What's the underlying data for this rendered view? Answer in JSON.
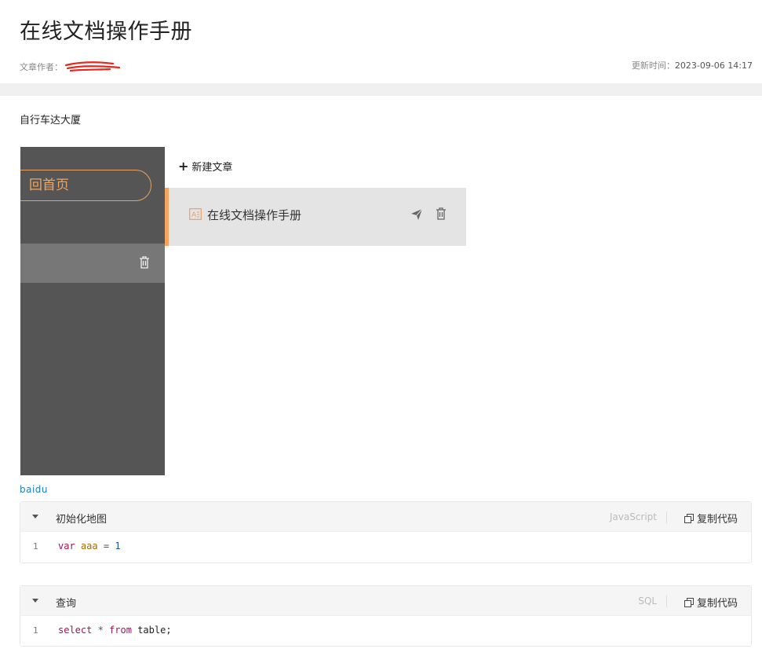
{
  "article": {
    "title": "在线文档操作手册",
    "author_label": "文章作者：",
    "updated_label": "更新时间：",
    "updated_value": "2023-09-06 14:17",
    "paragraph": "自行车达大厦",
    "link": "baidu"
  },
  "screenshot": {
    "home_button": "回首页",
    "new_article": "新建文章",
    "doc_title": "在线文档操作手册",
    "accent_color": "#f5a35e",
    "sidebar_color": "#555555"
  },
  "code_blocks": [
    {
      "title": "初始化地图",
      "language": "JavaScript",
      "copy_label": "复制代码",
      "lines": [
        {
          "number": "1",
          "tokens": {
            "kw": "var",
            "var": "aaa",
            "op": "=",
            "num": "1"
          }
        }
      ]
    },
    {
      "title": "查询",
      "language": "SQL",
      "copy_label": "复制代码",
      "lines": [
        {
          "number": "1",
          "tokens": {
            "kw1": "select",
            "op": "*",
            "kw2": "from",
            "plain": "table;"
          }
        }
      ]
    }
  ],
  "icons": {
    "caret": "caret-down-icon",
    "copy": "copy-icon",
    "trash": "trash-icon",
    "send": "send-icon",
    "doc": "document-icon"
  }
}
